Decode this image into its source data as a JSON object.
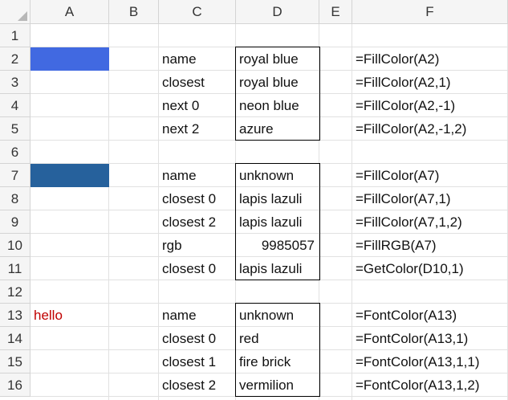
{
  "columns": [
    "A",
    "B",
    "C",
    "D",
    "E",
    "F"
  ],
  "rows": [
    "1",
    "2",
    "3",
    "4",
    "5",
    "6",
    "7",
    "8",
    "9",
    "10",
    "11",
    "12",
    "13",
    "14",
    "15",
    "16"
  ],
  "colors": {
    "royal_blue_fill": "#4169e1",
    "lapis_fill": "#26619c",
    "hello_font": "#c00000"
  },
  "cells": {
    "A13": "hello",
    "C2": "name",
    "D2": "royal blue",
    "F2": "=FillColor(A2)",
    "C3": "closest",
    "D3": "royal blue",
    "F3": "=FillColor(A2,1)",
    "C4": "next 0",
    "D4": "neon blue",
    "F4": "=FillColor(A2,-1)",
    "C5": "next 2",
    "D5": "azure",
    "F5": "=FillColor(A2,-1,2)",
    "C7": "name",
    "D7": "unknown",
    "F7": "=FillColor(A7)",
    "C8": "closest 0",
    "D8": "lapis lazuli",
    "F8": "=FillColor(A7,1)",
    "C9": "closest 2",
    "D9": "lapis lazuli",
    "F9": "=FillColor(A7,1,2)",
    "C10": "rgb",
    "D10": "9985057",
    "F10": "=FillRGB(A7)",
    "C11": "closest 0",
    "D11": "lapis lazuli",
    "F11": "=GetColor(D10,1)",
    "C13": "name",
    "D13": "unknown",
    "F13": "=FontColor(A13)",
    "C14": "closest 0",
    "D14": "red",
    "F14": "=FontColor(A13,1)",
    "C15": "closest 1",
    "D15": "fire brick",
    "F15": "=FontColor(A13,1,1)",
    "C16": "closest 2",
    "D16": "vermilion",
    "F16": "=FontColor(A13,1,2)"
  }
}
